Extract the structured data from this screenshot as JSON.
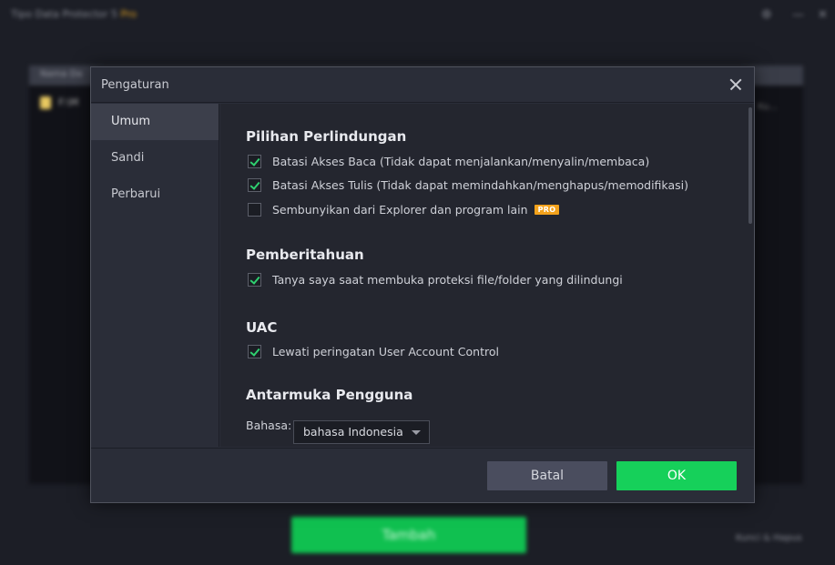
{
  "background": {
    "app_title": "Tipo Data Protector 5 ",
    "app_title_pro": "Pro",
    "header_label": "Nama Da",
    "row_label": "F:\\M",
    "add_button": "Tambah",
    "bottom_link": "Kunci & Hapus",
    "dropdown_hint": "Ku..."
  },
  "dialog": {
    "title": "Pengaturan",
    "sidebar": [
      {
        "label": "Umum",
        "active": true
      },
      {
        "label": "Sandi",
        "active": false
      },
      {
        "label": "Perbarui",
        "active": false
      }
    ],
    "sections": {
      "protection": {
        "title": "Pilihan Perlindungan",
        "options": [
          {
            "label": "Batasi Akses Baca (Tidak dapat menjalankan/menyalin/membaca)",
            "checked": true
          },
          {
            "label": "Batasi Akses Tulis (Tidak dapat memindahkan/menghapus/memodifikasi)",
            "checked": true
          },
          {
            "label": "Sembunyikan dari Explorer dan program lain",
            "checked": false,
            "badge": "PRO"
          }
        ]
      },
      "notification": {
        "title": "Pemberitahuan",
        "options": [
          {
            "label": "Tanya saya saat membuka proteksi file/folder yang dilindungi",
            "checked": true
          }
        ]
      },
      "uac": {
        "title": "UAC",
        "options": [
          {
            "label": "Lewati peringatan User Account Control",
            "checked": true
          }
        ]
      },
      "ui": {
        "title": "Antarmuka Pengguna",
        "language_label": "Bahasa:",
        "language_value": "bahasa Indonesia"
      }
    },
    "buttons": {
      "cancel": "Batal",
      "ok": "OK"
    }
  },
  "colors": {
    "accent_green": "#16d05a",
    "check_green": "#2fd070",
    "pro_badge": "#f3a21c"
  },
  "icons": [
    "close-icon",
    "checkbox-check-icon",
    "dropdown-arrow-icon",
    "folder-icon"
  ]
}
